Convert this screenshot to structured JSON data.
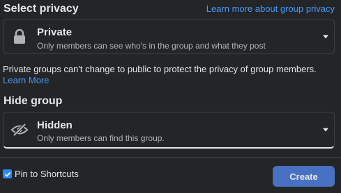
{
  "privacy": {
    "heading": "Select privacy",
    "learn_more_link": "Learn more about group privacy",
    "selected": {
      "icon": "lock-icon",
      "title": "Private",
      "description": "Only members can see who's in the group and what they post"
    },
    "note": "Private groups can't change to public to protect the privacy of group members.",
    "note_link": "Learn More"
  },
  "visibility": {
    "heading": "Hide group",
    "selected": {
      "icon": "eye-slash-icon",
      "title": "Hidden",
      "description": "Only members can find this group."
    }
  },
  "footer": {
    "pin_label": "Pin to Shortcuts",
    "pin_checked": true,
    "create_label": "Create"
  },
  "colors": {
    "background": "#242526",
    "accent_link": "#4599ff",
    "create_button": "#4871c1"
  }
}
